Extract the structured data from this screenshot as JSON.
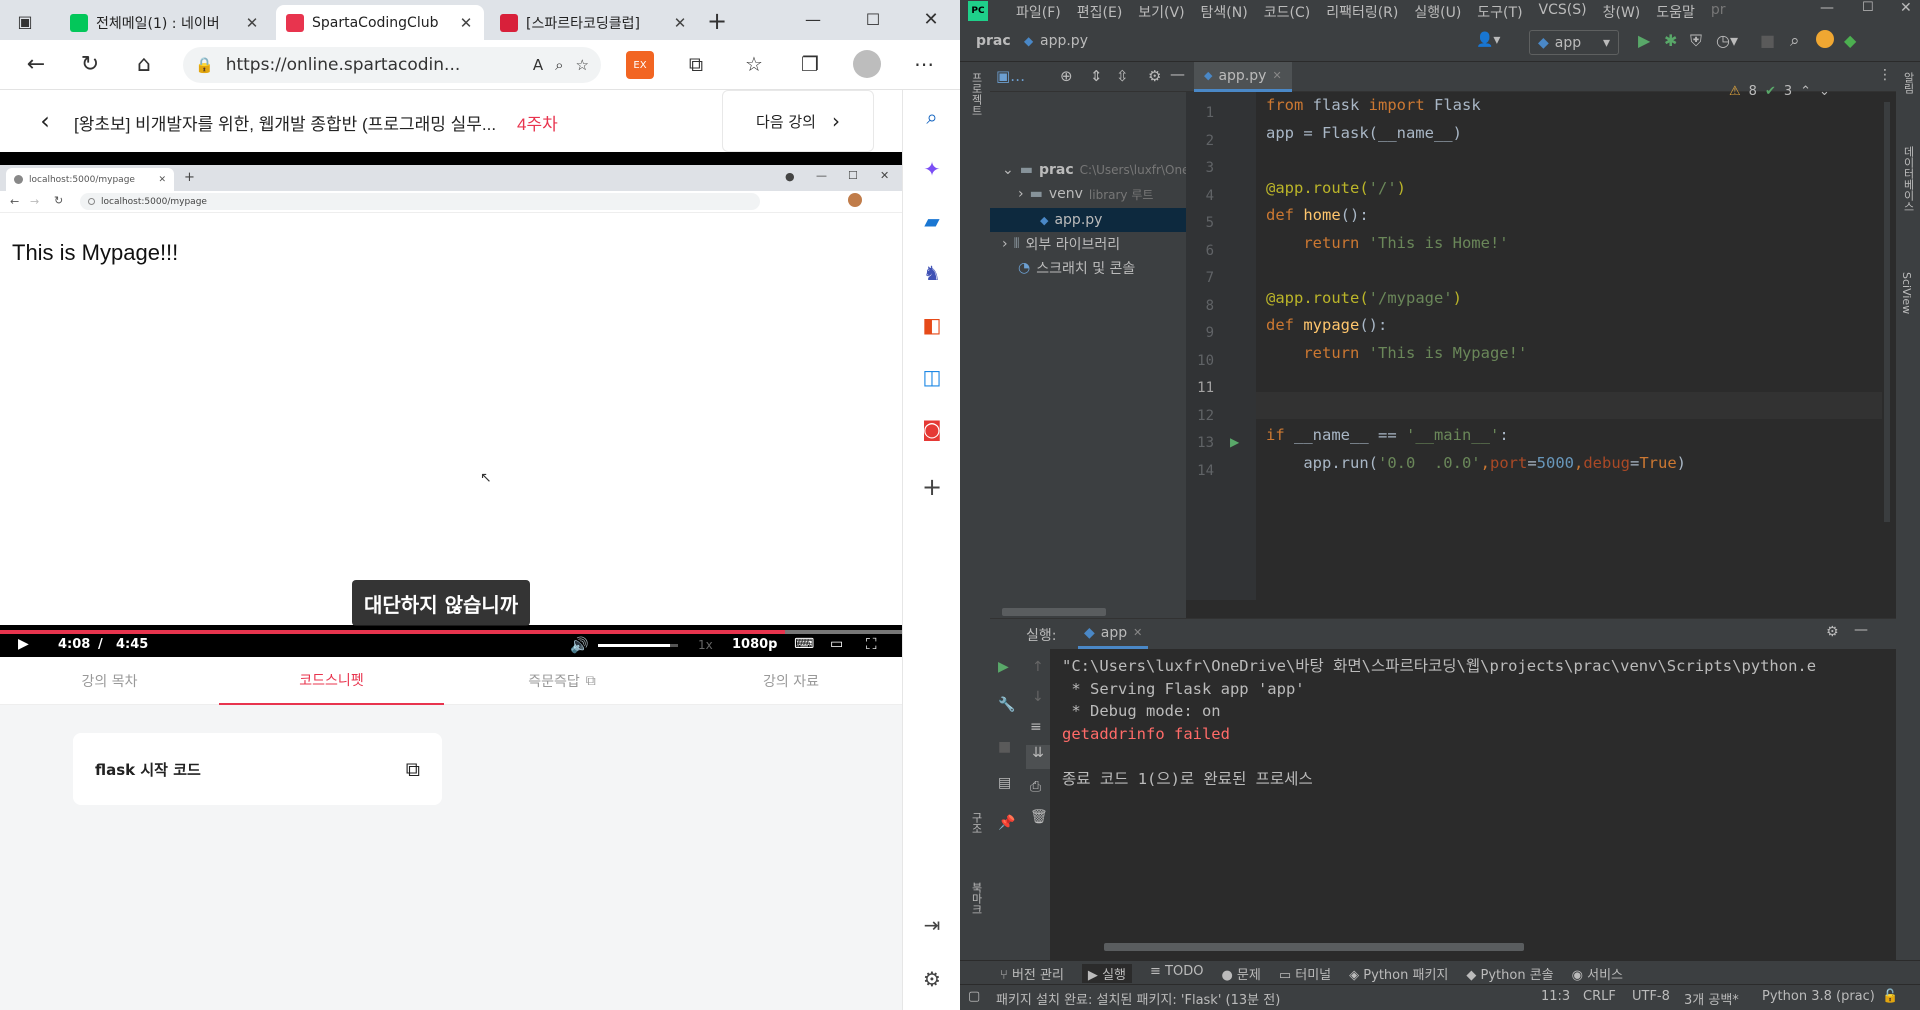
{
  "browser": {
    "tabs": [
      {
        "title": "전체메일(1) : 네이버",
        "fav": "#03c75a"
      },
      {
        "title": "SpartaCodingClub",
        "fav": "#e8344e"
      },
      {
        "title": "[스파르타코딩클럽]",
        "fav": "#e8344e"
      }
    ],
    "url": "https://online.spartacodin...",
    "sidebar_icons": [
      "search-icon",
      "copilot-icon",
      "briefcase-icon",
      "games-icon",
      "office-icon",
      "outlook-icon",
      "drop-icon",
      "add-icon",
      "split-icon",
      "settings-icon"
    ]
  },
  "course": {
    "title": "[왕초보] 비개발자를 위한, 웹개발 종합반 (프로그래밍 실무...",
    "week": "4주차",
    "next": "다음 강의",
    "video": {
      "inner_tab": "localhost:5000/mypage",
      "inner_url": "localhost:5000/mypage",
      "page_text": "This is Mypage!!!",
      "subtitle": "대단하지 않습니까",
      "current": "4:08",
      "sep": "/",
      "duration": "4:45",
      "speed": "1x",
      "quality": "1080p",
      "progress": 0.87,
      "volume": 0.9
    },
    "tabs": [
      "강의 목차",
      "코드스니펫",
      "즉문즉답",
      "강의 자료"
    ],
    "snippet": "flask 시작 코드"
  },
  "pycharm": {
    "menu": [
      "파일(F)",
      "편집(E)",
      "보기(V)",
      "탐색(N)",
      "코드(C)",
      "리팩터링(R)",
      "실행(U)",
      "도구(T)",
      "VCS(S)",
      "창(W)",
      "도움말",
      "pr"
    ],
    "breadcrumb": [
      "prac",
      "app.py"
    ],
    "run_config": "app",
    "tree": {
      "root": "prac",
      "root_path": "C:\\Users\\luxfr\\OneDriv",
      "venv": "venv",
      "venv_hint": "library 루트",
      "file": "app.py",
      "ext": "외부 라이브러리",
      "scratch": "스크래치 및 콘솔"
    },
    "editor_tab": "app.py",
    "inspections": {
      "warnings": "8",
      "ok": "3"
    },
    "code": [
      [
        {
          "t": "from ",
          "c": "kw"
        },
        {
          "t": "flask ",
          "c": ""
        },
        {
          "t": "import ",
          "c": "kw"
        },
        {
          "t": "Flask",
          "c": ""
        }
      ],
      [
        {
          "t": "app = Flask(__name__)",
          "c": ""
        }
      ],
      [],
      [
        {
          "t": "@app.route(",
          "c": "dec"
        },
        {
          "t": "'/'",
          "c": "str"
        },
        {
          "t": ")",
          "c": "dec"
        }
      ],
      [
        {
          "t": "def ",
          "c": "kw"
        },
        {
          "t": "home",
          "c": "fn"
        },
        {
          "t": "():",
          "c": ""
        }
      ],
      [
        {
          "t": "    return ",
          "c": "kw"
        },
        {
          "t": "'This is Home!'",
          "c": "str"
        }
      ],
      [],
      [
        {
          "t": "@app.route(",
          "c": "dec"
        },
        {
          "t": "'/mypage'",
          "c": "str"
        },
        {
          "t": ")",
          "c": "dec"
        }
      ],
      [
        {
          "t": "def ",
          "c": "kw"
        },
        {
          "t": "mypage",
          "c": "fn"
        },
        {
          "t": "():",
          "c": ""
        }
      ],
      [
        {
          "t": "    return ",
          "c": "kw"
        },
        {
          "t": "'This is Mypage!'",
          "c": "str"
        }
      ],
      [],
      [],
      [
        {
          "t": "if ",
          "c": "kw"
        },
        {
          "t": "__name__ == ",
          "c": ""
        },
        {
          "t": "'__main__'",
          "c": "str"
        },
        {
          "t": ":",
          "c": ""
        }
      ],
      [
        {
          "t": "    app.run(",
          "c": ""
        },
        {
          "t": "'0.0  .0.0'",
          "c": "str"
        },
        {
          "t": ",",
          "c": "kw"
        },
        {
          "t": "port",
          "c": "kwp"
        },
        {
          "t": "=",
          "c": ""
        },
        {
          "t": "5000",
          "c": "num"
        },
        {
          "t": ",",
          "c": "kw"
        },
        {
          "t": "debug",
          "c": "kwp"
        },
        {
          "t": "=",
          "c": ""
        },
        {
          "t": "True",
          "c": "kw"
        },
        {
          "t": ")",
          "c": ""
        }
      ]
    ],
    "run": {
      "label": "실행:",
      "tab": "app",
      "output": [
        {
          "t": "\"C:\\Users\\luxfr\\OneDrive\\바탕 화면\\스파르타코딩\\웹\\projects\\prac\\venv\\Scripts\\python.e",
          "c": "#bbbbbb"
        },
        {
          "t": " * Serving Flask app 'app'",
          "c": "#bbbbbb"
        },
        {
          "t": " * Debug mode: on",
          "c": "#bbbbbb"
        },
        {
          "t": "getaddrinfo failed",
          "c": "#ff6b68"
        },
        {
          "t": "",
          "c": "#bbbbbb"
        },
        {
          "t": "종료 코드 1(으)로 완료된 프로세스",
          "c": "#bbbbbb"
        }
      ]
    },
    "bottom_tabs": [
      "버전 관리",
      "실행",
      "TODO",
      "문제",
      "터미널",
      "Python 패키지",
      "Python 콘솔",
      "서비스"
    ],
    "status": {
      "message": "패키지 설치 완료: 설치된 패키지: 'Flask' (13분 전)",
      "pos": "11:3",
      "eol": "CRLF",
      "enc": "UTF-8",
      "indent": "3개 공백*",
      "interp": "Python 3.8 (prac)"
    },
    "left_labels": [
      "프로젝트",
      "구조",
      "북마크"
    ],
    "right_labels": [
      "알림",
      "데이터베이스",
      "SciView"
    ]
  }
}
